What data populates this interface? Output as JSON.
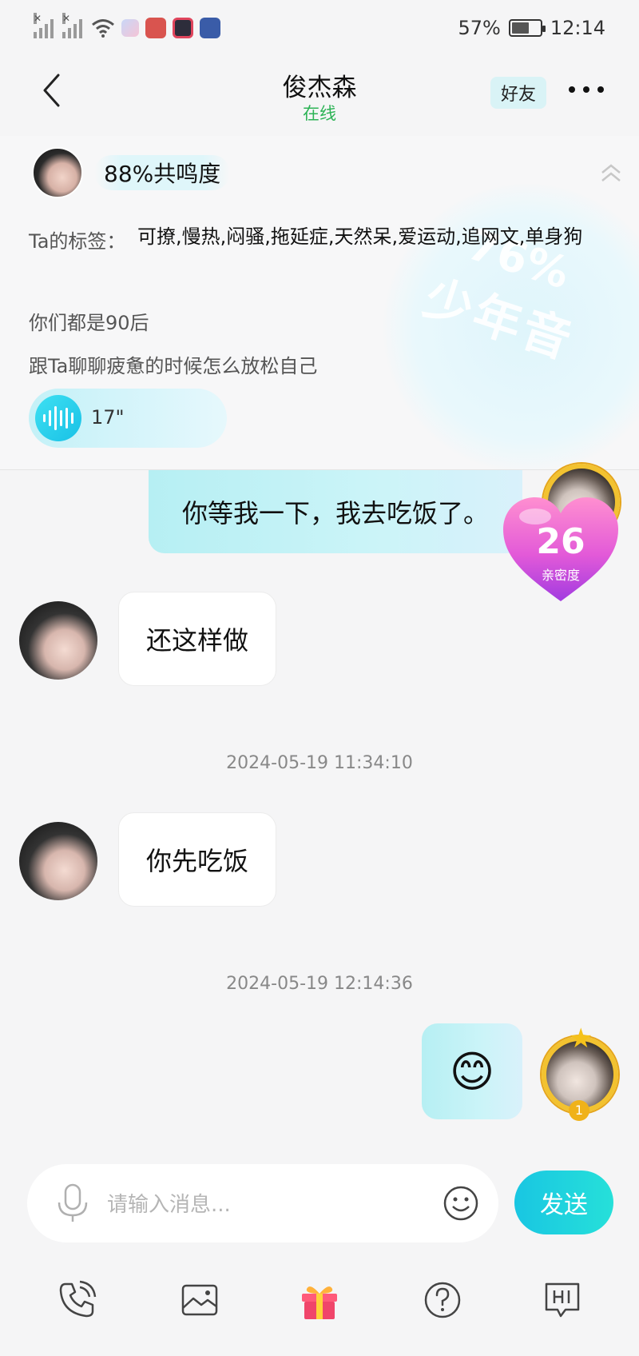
{
  "status_bar": {
    "battery_text": "57%",
    "battery_level": 0.57,
    "time": "12:14"
  },
  "header": {
    "title": "俊杰森",
    "subtitle": "在线",
    "friend_tag": "好友"
  },
  "profile_card": {
    "resonance": "88%共鸣度",
    "tags_label": "Ta的标签：",
    "tags_value": "可撩,慢热,闷骚,拖延症,天然呆,爱运动,追网文,单身狗",
    "age_text": "你们都是90后",
    "topic_text": "跟Ta聊聊疲惫的时候怎么放松自己",
    "voice_duration": "17\"",
    "watermark_percent": "76%",
    "watermark_label": "少年音"
  },
  "chat": {
    "messages": [
      {
        "direction": "out",
        "text": "你等我一下，我去吃饭了。"
      },
      {
        "direction": "in",
        "text": "还这样做"
      },
      {
        "type": "timestamp",
        "text": "2024-05-19 11:34:10"
      },
      {
        "direction": "in",
        "text": "你先吃饭"
      },
      {
        "type": "timestamp",
        "text": "2024-05-19 12:14:36"
      },
      {
        "direction": "out",
        "text": "😊"
      }
    ],
    "intimacy": {
      "value": "26",
      "label": "亲密度"
    },
    "my_level": "1"
  },
  "input": {
    "placeholder": "请输入消息...",
    "send_label": "发送"
  },
  "toolbar": {
    "items": [
      "phone-icon",
      "image-icon",
      "gift-icon",
      "question-icon",
      "hi-icon"
    ]
  },
  "colors": {
    "online_green": "#2db356",
    "accent_cyan": "#19c6e2",
    "gift_pink": "#f0456a"
  }
}
